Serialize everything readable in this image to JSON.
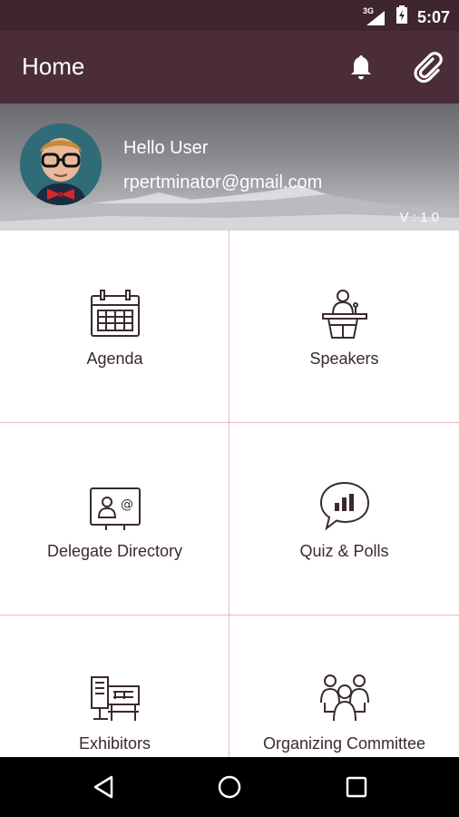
{
  "status_bar": {
    "network": "3G",
    "time": "5:07"
  },
  "app_bar": {
    "title": "Home",
    "icons": [
      "bell-icon",
      "paperclip-icon"
    ]
  },
  "profile": {
    "greeting": "Hello User",
    "email": "rpertminator@gmail.com",
    "version": "V : 1.0"
  },
  "menu": {
    "items": [
      {
        "label": "Agenda",
        "icon": "calendar-icon"
      },
      {
        "label": "Speakers",
        "icon": "podium-speaker-icon"
      },
      {
        "label": "Delegate Directory",
        "icon": "contact-card-icon"
      },
      {
        "label": "Quiz & Polls",
        "icon": "chat-bar-chart-icon"
      },
      {
        "label": "Exhibitors",
        "icon": "exhibitor-booth-icon"
      },
      {
        "label": "Organizing Committee",
        "icon": "group-people-icon"
      }
    ]
  },
  "nav_bar": {
    "icons": [
      "back-icon",
      "home-icon",
      "recents-icon"
    ]
  },
  "colors": {
    "app_bar": "#4a2d38",
    "status_bar": "#3f2530",
    "grid_lines": "#f0b5bb",
    "icon_stroke": "#3a2a2f"
  }
}
